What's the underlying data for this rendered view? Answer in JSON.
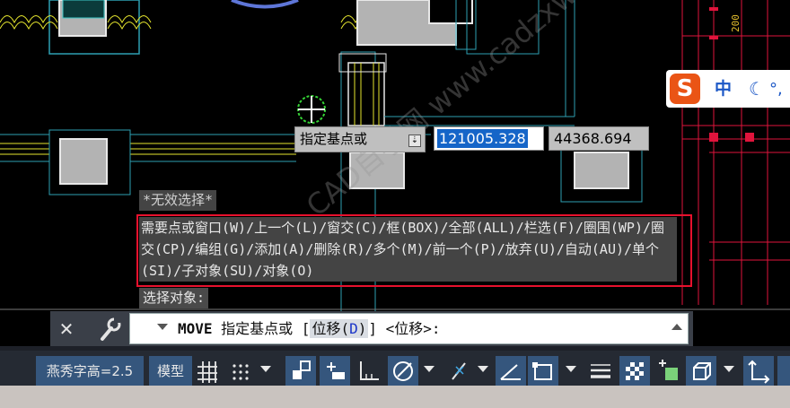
{
  "drawing": {
    "watermark": "CAD自学网 www.cadzxw.com"
  },
  "dynamic_input": {
    "prompt": "指定基点或",
    "x_value": "121005.328",
    "y_value": "44368.694"
  },
  "command_history": {
    "invalid": "*无效选择*",
    "message": "需要点或窗口(W)/上一个(L)/窗交(C)/框(BOX)/全部(ALL)/栏选(F)/圈围(WP)/圈交(CP)/编组(G)/添加(A)/删除(R)/多个(M)/前一个(P)/放弃(U)/自动(AU)/单个(SI)/子对象(SU)/对象(O)",
    "select_prompt": "选择对象:"
  },
  "command_line": {
    "command": "MOVE",
    "prompt_before": " 指定基点或 [",
    "option_label": "位移(",
    "option_key": "D",
    "option_close": ")",
    "prompt_after": "] <位移>:"
  },
  "status_bar": {
    "text_height": "燕秀字高=2.5",
    "model": "模型"
  },
  "ime": {
    "logo": "S",
    "mode": "中",
    "dot": "°,"
  },
  "colors": {
    "wall": "#b3b3b3",
    "cyan_lines": "#2e9fb2",
    "yellow_lines": "#e6e62e",
    "red_lines": "#e0143c",
    "selection_box": "#e8112d",
    "status_selected": "#35567d"
  }
}
